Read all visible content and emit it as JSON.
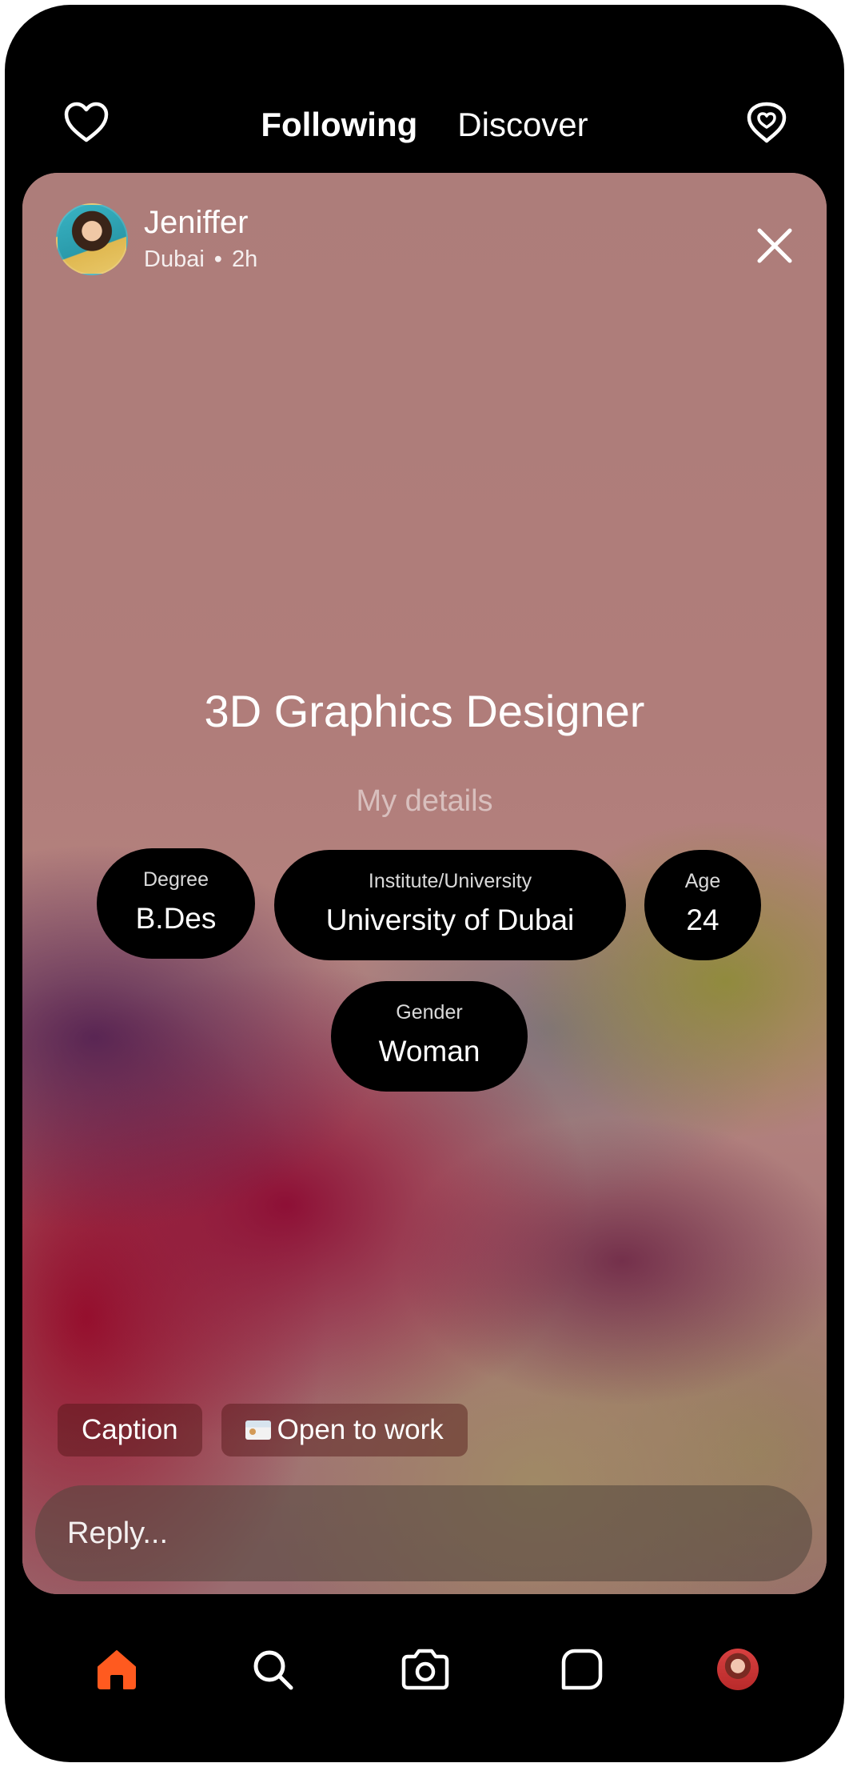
{
  "header": {
    "tabs": [
      {
        "label": "Following",
        "active": true
      },
      {
        "label": "Discover",
        "active": false
      }
    ],
    "left_icon": "heart-icon",
    "right_icon": "heart-pin-icon"
  },
  "story": {
    "author": {
      "name": "Jeniffer",
      "location": "Dubai",
      "separator": "•",
      "time": "2h"
    },
    "title": "3D Graphics Designer",
    "details_heading": "My details",
    "details": {
      "degree": {
        "label": "Degree",
        "value": "B.Des"
      },
      "institute": {
        "label": "Institute/University",
        "value": "University of Dubai"
      },
      "age": {
        "label": "Age",
        "value": "24"
      },
      "gender": {
        "label": "Gender",
        "value": "Woman"
      }
    },
    "tags": {
      "caption": "Caption",
      "open_to_work": "Open to work"
    },
    "reply": {
      "placeholder": "Reply..."
    }
  },
  "bottom_nav": {
    "items": [
      "home-icon",
      "search-icon",
      "camera-icon",
      "chat-icon",
      "profile-avatar"
    ],
    "accent_color": "#FF5A1F"
  }
}
